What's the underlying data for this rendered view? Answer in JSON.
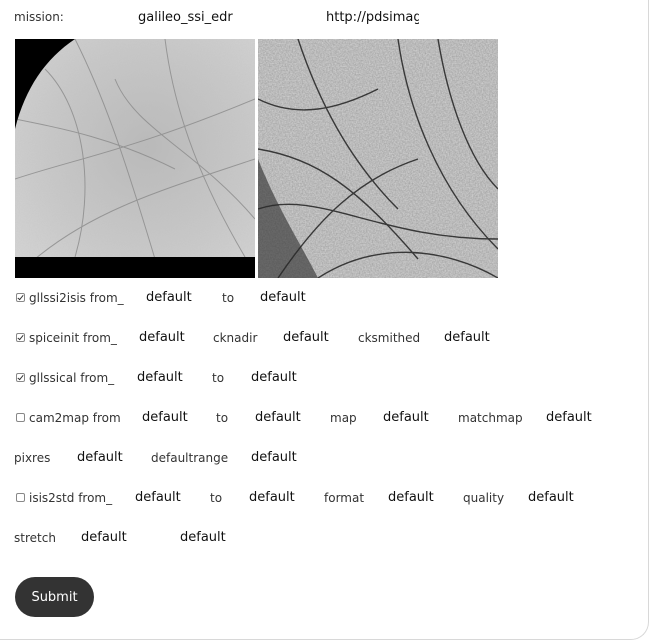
{
  "mission": {
    "label": "mission:",
    "value": "galileo_ssi_edr",
    "url": "http://pdsimage"
  },
  "images": [
    {
      "name": "raw-image-preview"
    },
    {
      "name": "processed-image-preview"
    }
  ],
  "gllssi2isis": {
    "checked": true,
    "label": "gllssi2isis from_",
    "from": "default",
    "to_label": "to",
    "to": "default"
  },
  "spiceinit": {
    "checked": true,
    "label": "spiceinit from_",
    "from": "default",
    "cknadir_label": "cknadir",
    "cknadir": "default",
    "cksmithed_label": "cksmithed",
    "cksmithed": "default"
  },
  "gllssical": {
    "checked": true,
    "label": "gllssical from_",
    "from": "default",
    "to_label": "to",
    "to": "default"
  },
  "cam2map": {
    "checked": false,
    "label": "cam2map from",
    "from": "default",
    "to_label": "to",
    "to": "default",
    "map_label": "map",
    "map": "default",
    "matchmap_label": "matchmap",
    "matchmap": "default",
    "pixres_label": "pixres",
    "pixres": "default",
    "defaultrange_label": "defaultrange",
    "defaultrange": "default"
  },
  "isis2std": {
    "checked": false,
    "label": "isis2std from_",
    "from": "default",
    "to_label": "to",
    "to": "default",
    "format_label": "format",
    "format": "default",
    "quality_label": "quality",
    "quality": "default",
    "stretch_label": "stretch",
    "stretch": "default",
    "extra": "default"
  },
  "submit_label": "Submit"
}
